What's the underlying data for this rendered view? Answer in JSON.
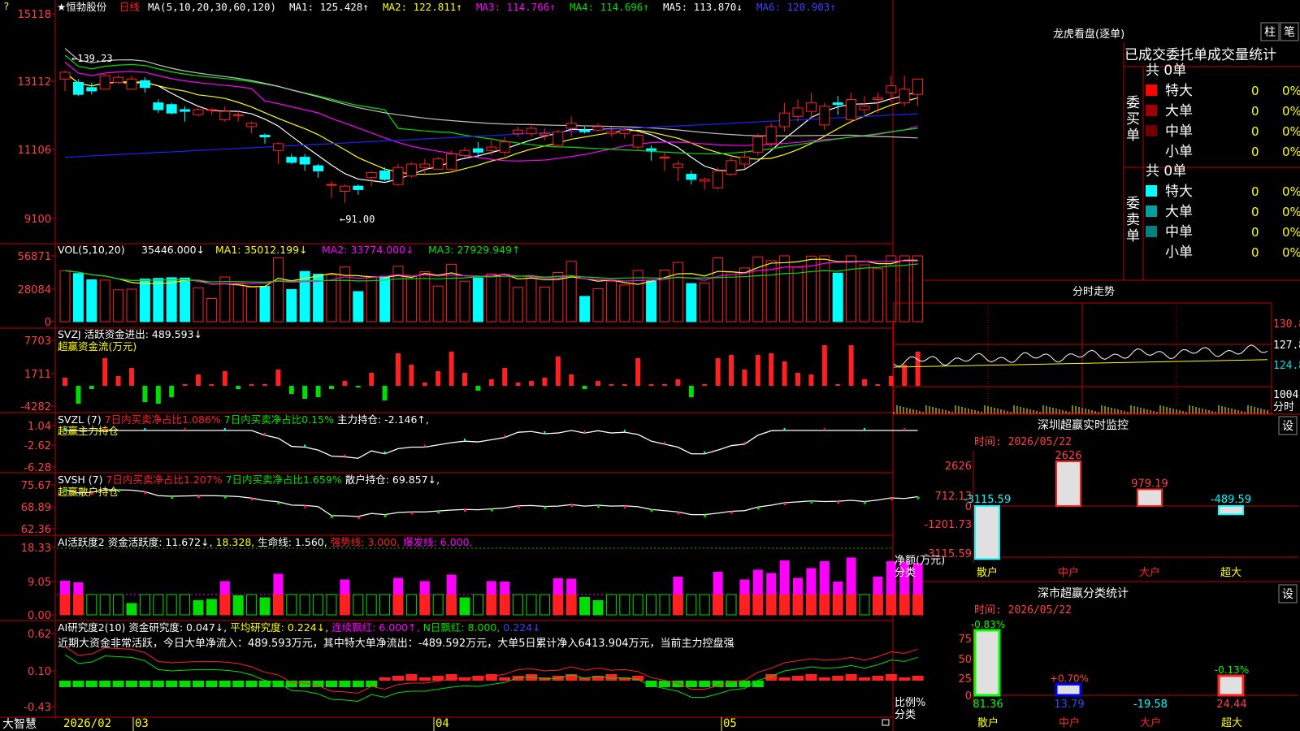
{
  "colors": {
    "up": "#ff2020",
    "down": "#00ffff",
    "frame": "#c00000",
    "ma1": "#ffffff",
    "ma2": "#ffff00",
    "ma3": "#ff00ff",
    "ma4": "#00e000",
    "ma5": "#c0c0c0",
    "ma6": "#2020ff",
    "green": "#00dd00",
    "magenta": "#ff00ff",
    "yellow": "#ffff00",
    "cyan": "#00ffff"
  },
  "stock": {
    "name": "★恒勃股份",
    "period": "日线",
    "ma_label": "MA(5,10,20,30,60,120)",
    "help_icon": "?"
  },
  "main_legend": [
    {
      "text": "MA1: 125.428↑",
      "color": "#ffffff"
    },
    {
      "text": "MA2: 122.811↑",
      "color": "#ffff00"
    },
    {
      "text": "MA3: 114.766↑",
      "color": "#ff00ff"
    },
    {
      "text": "MA4: 114.696↑",
      "color": "#00e000"
    },
    {
      "text": "MA5: 113.870↓",
      "color": "#ffffff"
    },
    {
      "text": "MA6: 120.903↑",
      "color": "#4040ff"
    }
  ],
  "main_axis": [
    "15118",
    "13112",
    "11106",
    "9100"
  ],
  "price_marks": {
    "high": "139.23",
    "low": "←91.00"
  },
  "vol_legend": [
    {
      "text": "VOL(5,10,20)",
      "color": "#ffffff"
    },
    {
      "text": "35446.000↓",
      "color": "#ffffff"
    },
    {
      "text": "MA1: 35012.199↓",
      "color": "#ffff00"
    },
    {
      "text": "MA2: 33774.000↓",
      "color": "#ff00ff"
    },
    {
      "text": "MA3: 27929.949↑",
      "color": "#00e000"
    }
  ],
  "vol_axis": [
    "56871",
    "28084",
    "0"
  ],
  "svzj": {
    "line1": "SVZJ  活跃资金进出: 489.593↓",
    "line2": "超赢资金流(万元)",
    "axis": [
      "7703",
      "1711",
      "-4282"
    ]
  },
  "svzl": {
    "title": "SVZL (7)",
    "s1": "7日内买卖净占比1.086%",
    "s2": "7日内买卖净占比0.15%",
    "s3": "主力持仓: -2.146↑,",
    "line2": "超赢主力持仓",
    "axis": [
      "1.04",
      "-2.62",
      "-6.28"
    ]
  },
  "svsh": {
    "title": "SVSH (7)",
    "s1": "7日内买卖净占比1.207%",
    "s2": "7日内买卖净占比1.659%",
    "s3": "散户持仓: 69.857↓,",
    "line2": "超赢散户持仓",
    "axis": [
      "75.67",
      "68.89",
      "62.36"
    ]
  },
  "ai1": {
    "title": "AI活跃度2",
    "s1": "资金活跃度: 11.672↓,",
    "s2": "18.328,",
    "s3": "生命线: 1.560,",
    "s4": "强势线: 3.000,",
    "s5": "爆发线: 6.000,",
    "axis": [
      "18.33",
      "9.05",
      "0.00"
    ]
  },
  "ai2": {
    "title": "AI研究度2(10)",
    "s1": "资金研究度: 0.047↓,",
    "s2": "平均研究度: 0.224↓,",
    "s3": "连续飘红: 6.000↑,",
    "s4": "N日飘红: 8.000,",
    "s5": "0.224↓",
    "comment": "近期大资金非常活跃，今日大单净流入：489.593万元，其中特大单净流出：-489.592万元，大单5日累计净入6413.904万元，当前主力控盘强",
    "axis": [
      "0.62",
      "0.10",
      "-0.43"
    ]
  },
  "bottom": {
    "brand": "大智慧",
    "date": "2026/02",
    "months": [
      "03",
      "04",
      "05"
    ]
  },
  "dragon": {
    "title": "龙虎看盘(逐单)",
    "tabs": [
      "柱",
      "笔"
    ],
    "header": "已成交委托单成交量统计",
    "buy": {
      "label": "委买单",
      "total": "共 0单",
      "rows": [
        {
          "name": "特大",
          "color": "#ff0000",
          "count": "0",
          "pct": "0%"
        },
        {
          "name": "大单",
          "color": "#a00000",
          "count": "0",
          "pct": "0%"
        },
        {
          "name": "中单",
          "color": "#700000",
          "count": "0",
          "pct": "0%"
        },
        {
          "name": "小单",
          "color": "",
          "count": "0",
          "pct": "0%"
        }
      ]
    },
    "sell": {
      "label": "委卖单",
      "total": "共 0单",
      "rows": [
        {
          "name": "特大",
          "color": "#00ffff",
          "count": "0",
          "pct": "0%"
        },
        {
          "name": "大单",
          "color": "#00a0a0",
          "count": "0",
          "pct": "0%"
        },
        {
          "name": "中单",
          "color": "#008080",
          "count": "0",
          "pct": "0%"
        },
        {
          "name": "小单",
          "color": "",
          "count": "0",
          "pct": "0%"
        }
      ]
    }
  },
  "intraday": {
    "title": "分时走势",
    "axis": [
      "130.8",
      "127.8",
      "124.8"
    ],
    "vol_label": "1004",
    "vol_unit": "分时"
  },
  "monitor": {
    "title": "深圳超赢实时监控",
    "set": "设",
    "time": "时间: 2026/05/22",
    "axis": [
      "2626",
      "712.13",
      "0",
      "-1201.73",
      "-3115.59"
    ],
    "ylabel": "净额(万元)",
    "xlabel": "分类",
    "bars": [
      {
        "cat": "散户",
        "value": -3115.59,
        "label": "-3115.59"
      },
      {
        "cat": "中户",
        "value": 2626,
        "label": "2626"
      },
      {
        "cat": "大户",
        "value": 979.19,
        "label": "979.19"
      },
      {
        "cat": "超大",
        "value": -489.59,
        "label": "-489.59"
      }
    ]
  },
  "classify": {
    "title": "深市超赢分类统计",
    "set": "设",
    "time": "时间: 2026/05/22",
    "axis": [
      "75",
      "50",
      "25",
      "0"
    ],
    "ylabel": "比例%",
    "xlabel": "分类",
    "bars": [
      {
        "cat": "散户",
        "value": 81.36,
        "label": "81.36",
        "delta": "-0.83%"
      },
      {
        "cat": "中户",
        "value": 13.79,
        "label": "13.79",
        "delta": "+0.70%"
      },
      {
        "cat": "大户",
        "value": -19.58,
        "label": "-19.58",
        "delta": ""
      },
      {
        "cat": "超大",
        "value": 24.44,
        "label": "24.44",
        "delta": "-0.13%"
      }
    ]
  },
  "chart_data": {
    "type": "candlestick",
    "dates_start": "2026/02",
    "ylim": [
      9100,
      15118
    ],
    "candles": [
      [
        13200,
        13400,
        12900,
        13450,
        12850
      ],
      [
        13100,
        12750,
        13000,
        13200,
        12700
      ],
      [
        12950,
        12850,
        12800,
        13100,
        12750
      ],
      [
        12900,
        13300,
        12950,
        13350,
        12900
      ],
      [
        13100,
        13250,
        13150,
        13300,
        13050
      ],
      [
        12900,
        13200,
        13150,
        13300,
        13100
      ],
      [
        13150,
        12950,
        13100,
        13250,
        12800
      ],
      [
        12500,
        12300,
        12400,
        12600,
        12200
      ],
      [
        12450,
        12200,
        12400,
        12500,
        12150
      ],
      [
        12300,
        12250,
        12250,
        12400,
        11950
      ],
      [
        12150,
        12300,
        12150,
        12350,
        12100
      ],
      [
        12300,
        12300,
        12200,
        12350,
        12150
      ],
      [
        12000,
        12250,
        12000,
        12400,
        11950
      ],
      [
        12150,
        12150,
        12050,
        12250,
        11950
      ],
      [
        11800,
        11900,
        11700,
        11950,
        11600
      ],
      [
        11550,
        11500,
        11400,
        11600,
        11300
      ],
      [
        11100,
        11300,
        10800,
        11350,
        10700
      ],
      [
        10900,
        10750,
        10900,
        11000,
        10700
      ],
      [
        10900,
        10700,
        10900,
        11000,
        10500
      ],
      [
        10650,
        10500,
        10350,
        10700,
        10300
      ],
      [
        10100,
        10100,
        10000,
        10200,
        9700
      ],
      [
        9900,
        10050,
        9650,
        10100,
        9550
      ],
      [
        10050,
        9950,
        9900,
        10100,
        9800
      ],
      [
        10300,
        10450,
        10150,
        10500,
        10050
      ],
      [
        10500,
        10250,
        10350,
        10600,
        10200
      ],
      [
        10100,
        10600,
        10200,
        10700,
        10050
      ],
      [
        10350,
        10700,
        10400,
        10750,
        10300
      ],
      [
        10600,
        10700,
        10450,
        10850,
        10400
      ],
      [
        10550,
        10850,
        10600,
        10900,
        10550
      ],
      [
        10550,
        11000,
        10950,
        11100,
        10500
      ],
      [
        10950,
        11100,
        11100,
        11200,
        10900
      ],
      [
        11150,
        11050,
        11000,
        11350,
        10900
      ],
      [
        11100,
        11200,
        11050,
        11400,
        10950
      ],
      [
        11050,
        11350,
        11200,
        11500,
        10950
      ],
      [
        11600,
        11700,
        11650,
        11800,
        11500
      ],
      [
        11600,
        11750,
        11750,
        11900,
        11500
      ],
      [
        11550,
        11600,
        11500,
        11750,
        11400
      ],
      [
        11250,
        11650,
        11550,
        11700,
        11200
      ],
      [
        11750,
        11900,
        11700,
        12100,
        11500
      ],
      [
        11700,
        11650,
        11700,
        11800,
        11600
      ],
      [
        11700,
        11800,
        11750,
        11900,
        11650
      ],
      [
        11600,
        11650,
        11600,
        11800,
        11500
      ],
      [
        11600,
        11700,
        11550,
        11800,
        11450
      ],
      [
        11200,
        11550,
        11200,
        11600,
        11100
      ],
      [
        11150,
        11100,
        11000,
        11250,
        10800
      ],
      [
        10900,
        10900,
        10700,
        11050,
        10500
      ],
      [
        10600,
        10700,
        10300,
        10800,
        10200
      ],
      [
        10400,
        10250,
        10200,
        10500,
        10100
      ],
      [
        10200,
        10250,
        10100,
        10300,
        9950
      ],
      [
        10000,
        10500,
        10350,
        10600,
        9950
      ],
      [
        10400,
        10800,
        10750,
        10900,
        10350
      ],
      [
        10700,
        10900,
        10850,
        11100,
        10550
      ],
      [
        11050,
        11500,
        11300,
        11600,
        10950
      ],
      [
        11300,
        11800,
        11700,
        11900,
        11200
      ],
      [
        11800,
        12200,
        12050,
        12500,
        11650
      ],
      [
        12100,
        12350,
        12150,
        12600,
        11950
      ],
      [
        12250,
        12500,
        12350,
        12800,
        12050
      ],
      [
        11850,
        12400,
        12100,
        12500,
        11700
      ],
      [
        12500,
        12450,
        12350,
        12700,
        12150
      ],
      [
        12000,
        12600,
        12200,
        12800,
        11900
      ],
      [
        12300,
        12400,
        12400,
        12700,
        12150
      ],
      [
        12600,
        12650,
        12550,
        12800,
        12200
      ],
      [
        12800,
        13000,
        12550,
        13300,
        12500
      ],
      [
        12500,
        12900,
        12850,
        13300,
        12400
      ],
      [
        12750,
        13200,
        12850,
        13200,
        12400
      ]
    ]
  }
}
